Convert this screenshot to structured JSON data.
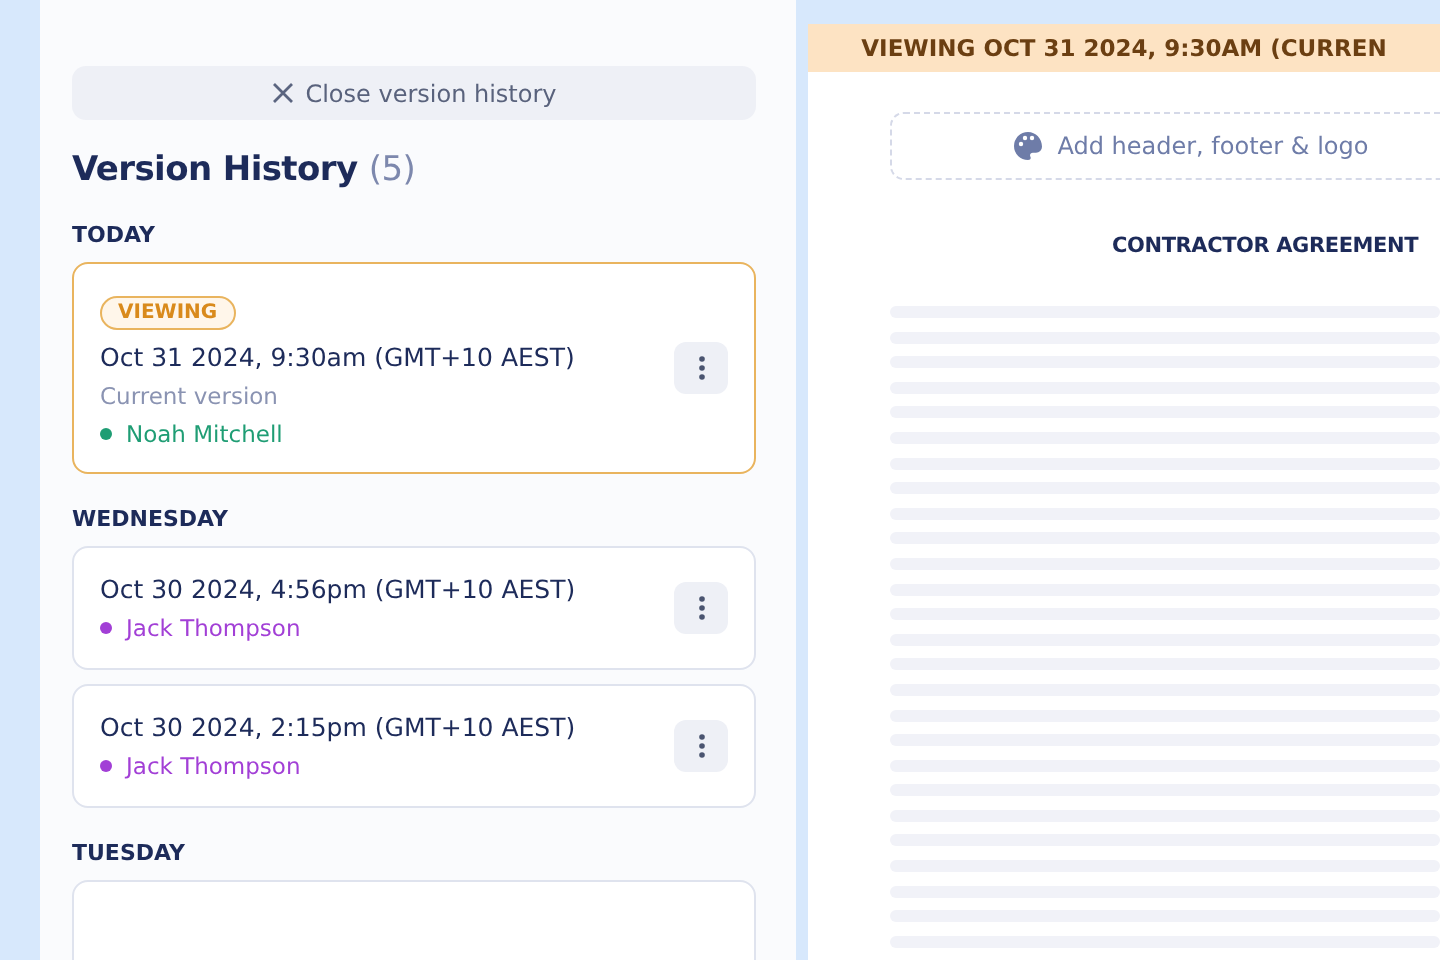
{
  "sidebar": {
    "close_button": "Close version history",
    "title": "Version History",
    "count": "(5)",
    "groups": [
      {
        "label": "TODAY",
        "versions": [
          {
            "time": "Oct 31 2024, 9:30am (GMT+10 AEST)",
            "selected": true,
            "badge": "VIEWING",
            "note": "Current version",
            "author": "Noah Mitchell",
            "color": "#1f9d74"
          }
        ]
      },
      {
        "label": "WEDNESDAY",
        "versions": [
          {
            "time": "Oct 30 2024, 4:56pm (GMT+10 AEST)",
            "selected": false,
            "author": "Jack Thompson",
            "color": "#a23fd6"
          },
          {
            "time": "Oct 30 2024, 2:15pm (GMT+10 AEST)",
            "selected": false,
            "author": "Jack Thompson",
            "color": "#a23fd6"
          }
        ]
      },
      {
        "label": "TUESDAY",
        "versions": [
          {
            "selected": false
          }
        ]
      }
    ]
  },
  "document": {
    "banner": "VIEWING OCT 31 2024, 9:30AM (CURREN",
    "header_prompt": "Add header, footer & logo",
    "title": "CONTRACTOR AGREEMENT"
  }
}
